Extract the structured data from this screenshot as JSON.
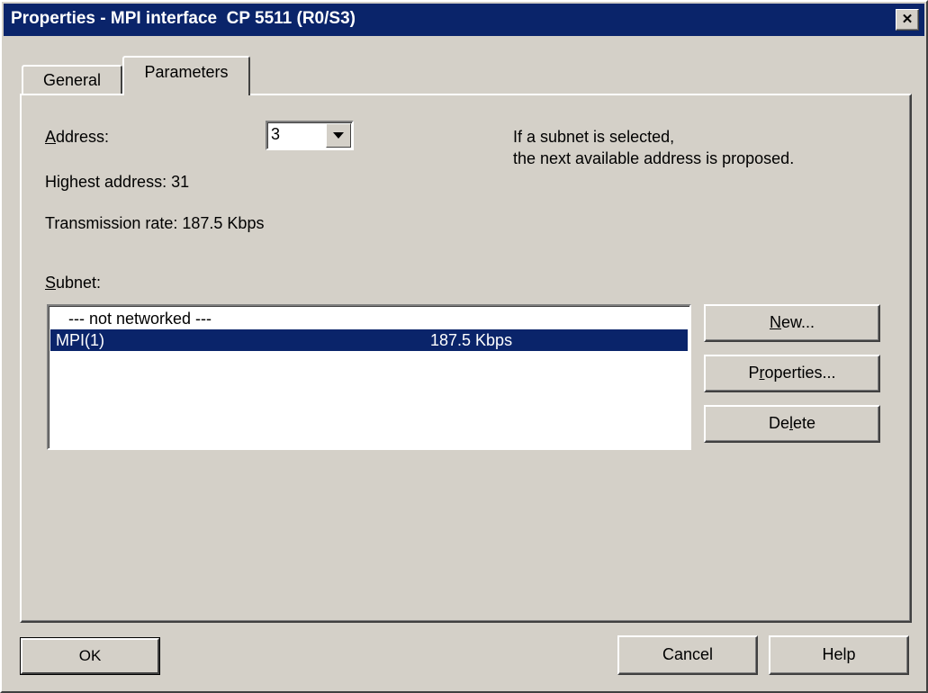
{
  "window": {
    "title": "Properties - MPI interface  CP 5511 (R0/S3)",
    "close_glyph": "✕"
  },
  "tabs": [
    {
      "label": "General",
      "active": false
    },
    {
      "label": "Parameters",
      "active": true
    }
  ],
  "address": {
    "label_accel": "A",
    "label_rest": "ddress:",
    "value": "3"
  },
  "hint": {
    "line1": "If a subnet is selected,",
    "line2": "the next available address is proposed."
  },
  "highest_address": "Highest address:  31",
  "transmission_rate": "Transmission rate: 187.5 Kbps",
  "subnet": {
    "label_accel": "S",
    "label_rest": "ubnet:",
    "rows": [
      {
        "name": "--- not networked ---",
        "rate": "",
        "selected": false
      },
      {
        "name": "MPI(1)",
        "rate": "187.5 Kbps",
        "selected": true
      }
    ]
  },
  "side_buttons": {
    "new": {
      "pre": "",
      "accel": "N",
      "post": "ew..."
    },
    "properties": {
      "pre": "P",
      "accel": "r",
      "post": "operties..."
    },
    "delete": {
      "pre": "De",
      "accel": "l",
      "post": "ete"
    }
  },
  "footer": {
    "ok": "OK",
    "cancel": "Cancel",
    "help": "Help"
  }
}
